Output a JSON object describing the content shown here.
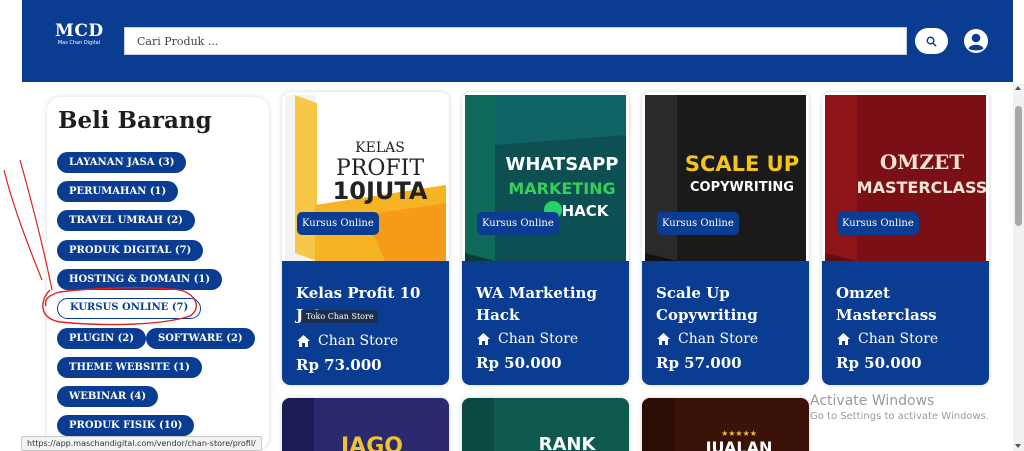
{
  "header": {
    "logo_text": "MCD",
    "logo_sub": "Mas Chan Digital",
    "search_placeholder": "Cari Produk ..."
  },
  "sidebar": {
    "title": "Beli Barang",
    "categories": [
      "LAYANAN JASA (3)",
      "PERUMAHAN (1)",
      "TRAVEL UMRAH (2)",
      "PRODUK DIGITAL (7)",
      "HOSTING & DOMAIN (1)",
      "KURSUS ONLINE (7)",
      "PLUGIN (2)",
      "SOFTWARE (2)",
      "THEME WEBSITE (1)",
      "WEBINAR (4)",
      "PRODUK FISIK (10)"
    ],
    "active_category": "KURSUS ONLINE (7)"
  },
  "products": [
    {
      "name": "Kelas Profit 10 Juta",
      "badge": "Kursus Online",
      "store": "Chan Store",
      "price": "Rp 73.000",
      "cover_line1": "KELAS",
      "cover_line2": "PROFIT",
      "cover_line3": "10JUTA"
    },
    {
      "name": "WA Marketing Hack",
      "badge": "Kursus Online",
      "store": "Chan Store",
      "price": "Rp 50.000",
      "cover_line1": "WHATSAPP",
      "cover_line2": "MARKETING",
      "cover_line3": "HACK"
    },
    {
      "name": "Scale Up Copywriting",
      "badge": "Kursus Online",
      "store": "Chan Store",
      "price": "Rp 57.000",
      "cover_line1": "SCALE UP",
      "cover_line2": "COPYWRITING"
    },
    {
      "name": "Omzet Masterclass",
      "badge": "Kursus Online",
      "store": "Chan Store",
      "price": "Rp 50.000",
      "cover_line1": "OMZET",
      "cover_line2": "MASTERCLASS"
    }
  ],
  "second_row": [
    {
      "cover_text": "JAGO"
    },
    {
      "cover_text": "RANK"
    },
    {
      "cover_text": "JUALAN"
    }
  ],
  "tooltip": "Toko Chan Store",
  "overlay": {
    "activate_title": "Activate Windows",
    "activate_sub": "Go to Settings to activate Windows."
  },
  "status_url": "https://app.maschandigital.com/vendor/chan-store/profil/",
  "colors": {
    "brand": "#0a3d91",
    "annotation": "#e0221f"
  },
  "icons": {
    "search": "search-icon",
    "user": "user-icon",
    "store": "home-icon"
  }
}
